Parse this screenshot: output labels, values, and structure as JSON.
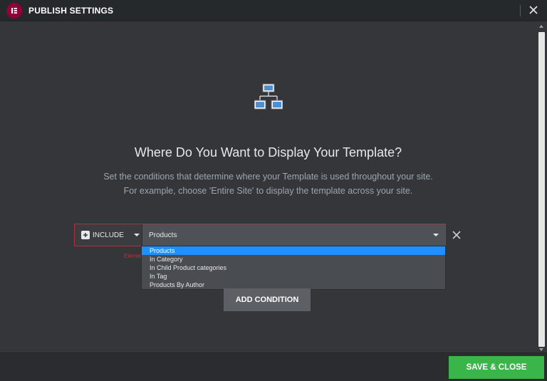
{
  "header": {
    "title": "PUBLISH SETTINGS",
    "logo_icon": "elementor-logo",
    "close_icon": "close-icon"
  },
  "main": {
    "hero_icon": "sitemap-icon",
    "title": "Where Do You Want to Display Your Template?",
    "subtitle_line1": "Set the conditions that determine where your Template is used throughout your site.",
    "subtitle_line2": "For example, choose 'Entire Site' to display the template across your site."
  },
  "condition": {
    "include_label": "INCLUDE",
    "selected_value": "Products",
    "error_text": "Elemen",
    "options": [
      "Products",
      "In Category",
      "In Child Product categories",
      "In Tag",
      "Products By Author"
    ],
    "selected_index": 0
  },
  "buttons": {
    "add_condition": "ADD CONDITION",
    "save_close": "SAVE & CLOSE"
  },
  "colors": {
    "accent_green": "#39b54a",
    "selection_blue": "#1e90ff",
    "logo": "#92003b",
    "error_border": "#a4343f"
  }
}
